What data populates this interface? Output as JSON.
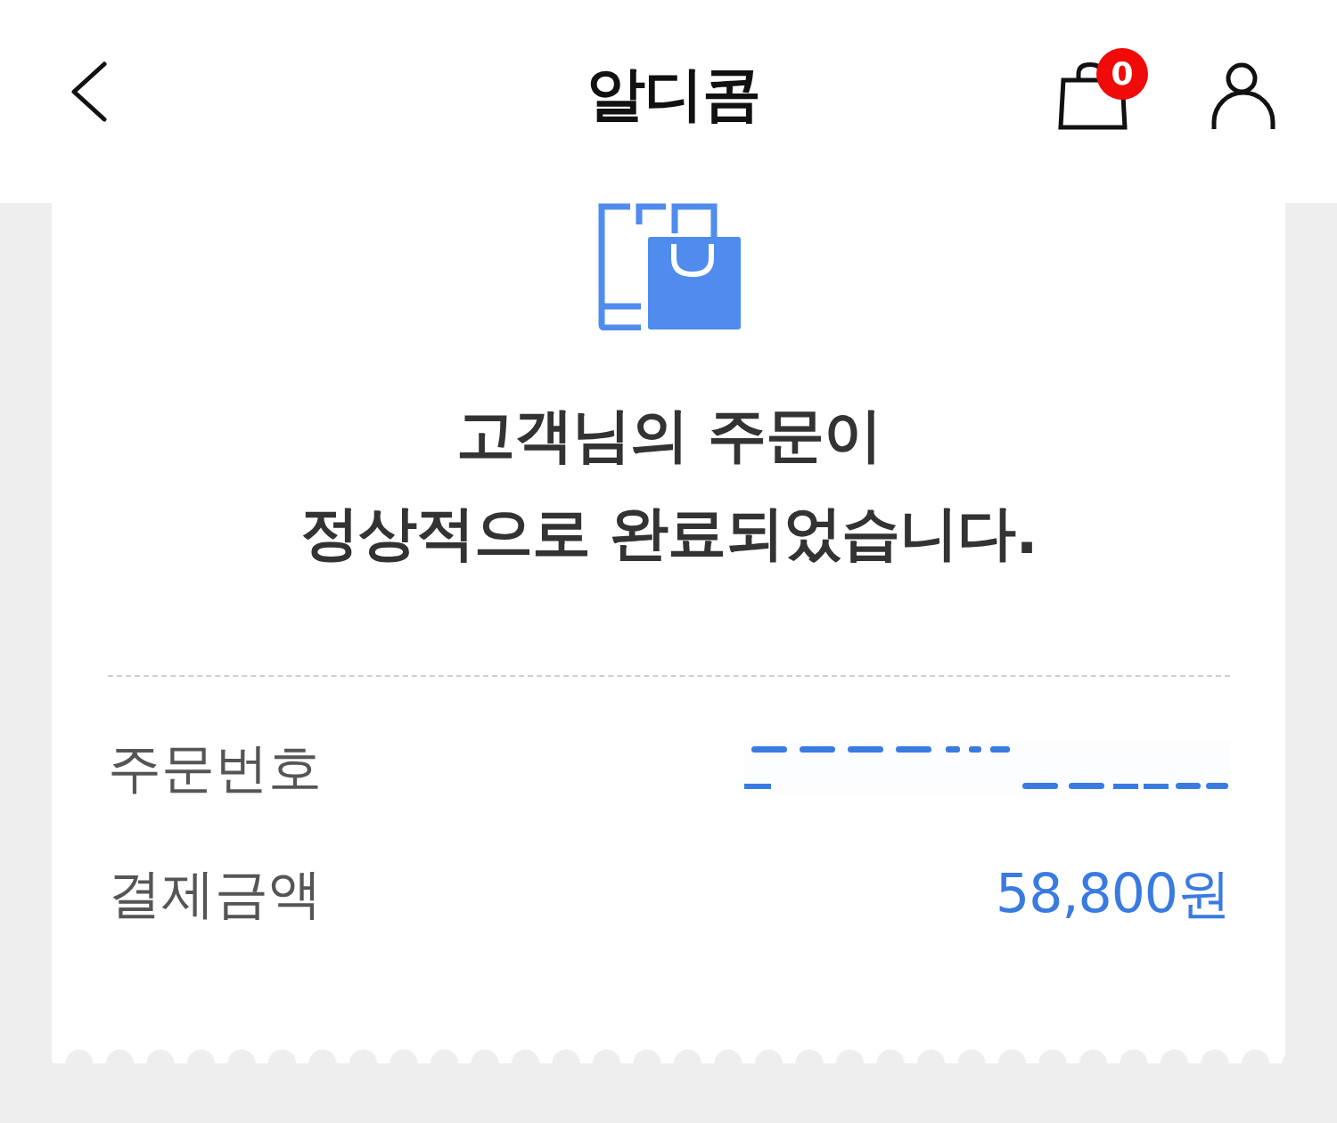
{
  "header": {
    "title": "알디콤",
    "cart_badge": "0"
  },
  "order_complete": {
    "message": "고객님의 주문이\n정상적으로 완료되었습니다."
  },
  "details": [
    {
      "kind": "redacted",
      "label": "주문번호"
    },
    {
      "kind": "text",
      "label": "결제금액",
      "value": "58,800원"
    }
  ]
}
